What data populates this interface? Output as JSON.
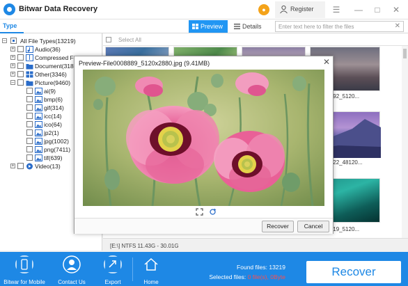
{
  "titlebar": {
    "app_title": "Bitwar Data Recovery",
    "register_label": "Register",
    "icons": [
      "app-logo-icon",
      "cart-icon",
      "user-icon",
      "menu-icon",
      "minimize-icon",
      "maximize-icon",
      "close-icon"
    ]
  },
  "toolbar": {
    "type_tab": "Type",
    "preview_label": "Preview",
    "details_label": "Details",
    "filter_placeholder": "Enter text here to filter the files"
  },
  "tree": {
    "root": "All File Types(13219)",
    "items": [
      {
        "label": "Audio(36)",
        "depth": 1,
        "expander": "+"
      },
      {
        "label": "Compressed File(",
        "depth": 1,
        "expander": "+"
      },
      {
        "label": "Document(318)",
        "depth": 1,
        "expander": "+"
      },
      {
        "label": "Other(3346)",
        "depth": 1,
        "expander": "+"
      },
      {
        "label": "Picture(9460)",
        "depth": 1,
        "expander": "-"
      },
      {
        "label": "ai(9)",
        "depth": 2
      },
      {
        "label": "bmp(6)",
        "depth": 2
      },
      {
        "label": "gif(314)",
        "depth": 2
      },
      {
        "label": "icc(14)",
        "depth": 2
      },
      {
        "label": "ico(64)",
        "depth": 2
      },
      {
        "label": "jp2(1)",
        "depth": 2
      },
      {
        "label": "jpg(1002)",
        "depth": 2
      },
      {
        "label": "png(7411)",
        "depth": 2
      },
      {
        "label": "tif(639)",
        "depth": 2
      },
      {
        "label": "Video(13)",
        "depth": 1,
        "expander": "+"
      }
    ]
  },
  "main": {
    "select_all": "Select All",
    "thumb_labels": [
      "0008892_5120...",
      "0008922_48120...",
      "0008919_5120..."
    ]
  },
  "status": "[E:\\] NTFS 11.43G - 30.01G",
  "bottom": {
    "buttons": [
      {
        "label": "Bitwar for Mobile"
      },
      {
        "label": "Contact Us"
      },
      {
        "label": "Export"
      },
      {
        "label": "Home"
      }
    ],
    "found_files": "Found files: 13219",
    "selected_prefix": "Selected files: ",
    "selected_count": "0 file(s),",
    "selected_size": "0Byte",
    "recover_label": "Recover"
  },
  "dialog": {
    "title": "Preview-File0008889_5120x2880.jpg (9.41MB)",
    "recover_label": "Recover",
    "cancel_label": "Cancel"
  },
  "colors": {
    "accent": "#1e88e5",
    "preview_tab": "#2196f3",
    "warning": "#ff4d4d"
  }
}
